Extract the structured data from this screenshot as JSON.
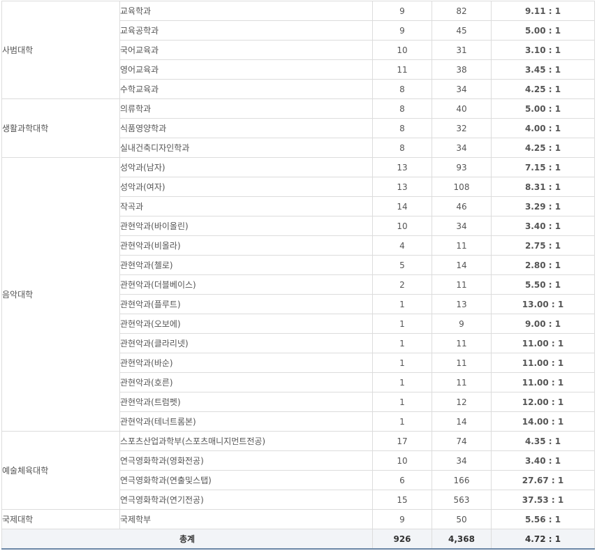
{
  "table": {
    "colleges": [
      {
        "name": "사범대학",
        "rows": [
          {
            "dept": "교육학과",
            "quota": "9",
            "applicants": "82",
            "ratio": "9.11 : 1"
          },
          {
            "dept": "교육공학과",
            "quota": "9",
            "applicants": "45",
            "ratio": "5.00 : 1"
          },
          {
            "dept": "국어교육과",
            "quota": "10",
            "applicants": "31",
            "ratio": "3.10 : 1"
          },
          {
            "dept": "영어교육과",
            "quota": "11",
            "applicants": "38",
            "ratio": "3.45 : 1"
          },
          {
            "dept": "수학교육과",
            "quota": "8",
            "applicants": "34",
            "ratio": "4.25 : 1"
          }
        ]
      },
      {
        "name": "생활과학대학",
        "rows": [
          {
            "dept": "의류학과",
            "quota": "8",
            "applicants": "40",
            "ratio": "5.00 : 1"
          },
          {
            "dept": "식품영양학과",
            "quota": "8",
            "applicants": "32",
            "ratio": "4.00 : 1"
          },
          {
            "dept": "실내건축디자인학과",
            "quota": "8",
            "applicants": "34",
            "ratio": "4.25 : 1"
          }
        ]
      },
      {
        "name": "음악대학",
        "rows": [
          {
            "dept": "성악과(남자)",
            "quota": "13",
            "applicants": "93",
            "ratio": "7.15 : 1"
          },
          {
            "dept": "성악과(여자)",
            "quota": "13",
            "applicants": "108",
            "ratio": "8.31 : 1"
          },
          {
            "dept": "작곡과",
            "quota": "14",
            "applicants": "46",
            "ratio": "3.29 : 1"
          },
          {
            "dept": "관현악과(바이올린)",
            "quota": "10",
            "applicants": "34",
            "ratio": "3.40 : 1"
          },
          {
            "dept": "관현악과(비올라)",
            "quota": "4",
            "applicants": "11",
            "ratio": "2.75 : 1"
          },
          {
            "dept": "관현악과(첼로)",
            "quota": "5",
            "applicants": "14",
            "ratio": "2.80 : 1"
          },
          {
            "dept": "관현악과(더블베이스)",
            "quota": "2",
            "applicants": "11",
            "ratio": "5.50 : 1"
          },
          {
            "dept": "관현악과(플루트)",
            "quota": "1",
            "applicants": "13",
            "ratio": "13.00 : 1"
          },
          {
            "dept": "관현악과(오보에)",
            "quota": "1",
            "applicants": "9",
            "ratio": "9.00 : 1"
          },
          {
            "dept": "관현악과(클라리넷)",
            "quota": "1",
            "applicants": "11",
            "ratio": "11.00 : 1"
          },
          {
            "dept": "관현악과(바순)",
            "quota": "1",
            "applicants": "11",
            "ratio": "11.00 : 1"
          },
          {
            "dept": "관현악과(호른)",
            "quota": "1",
            "applicants": "11",
            "ratio": "11.00 : 1"
          },
          {
            "dept": "관현악과(트럼펫)",
            "quota": "1",
            "applicants": "12",
            "ratio": "12.00 : 1"
          },
          {
            "dept": "관현악과(테너트롬본)",
            "quota": "1",
            "applicants": "14",
            "ratio": "14.00 : 1"
          }
        ]
      },
      {
        "name": "예술체육대학",
        "rows": [
          {
            "dept": "스포츠산업과학부(스포츠매니지먼트전공)",
            "quota": "17",
            "applicants": "74",
            "ratio": "4.35 : 1"
          },
          {
            "dept": "연극영화학과(영화전공)",
            "quota": "10",
            "applicants": "34",
            "ratio": "3.40 : 1"
          },
          {
            "dept": "연극영화학과(연출및스탭)",
            "quota": "6",
            "applicants": "166",
            "ratio": "27.67 : 1"
          },
          {
            "dept": "연극영화학과(연기전공)",
            "quota": "15",
            "applicants": "563",
            "ratio": "37.53 : 1"
          }
        ]
      },
      {
        "name": "국제대학",
        "rows": [
          {
            "dept": "국제학부",
            "quota": "9",
            "applicants": "50",
            "ratio": "5.56 : 1"
          }
        ]
      }
    ],
    "total": {
      "label": "총계",
      "quota": "926",
      "applicants": "4,368",
      "ratio": "4.72 : 1"
    }
  }
}
